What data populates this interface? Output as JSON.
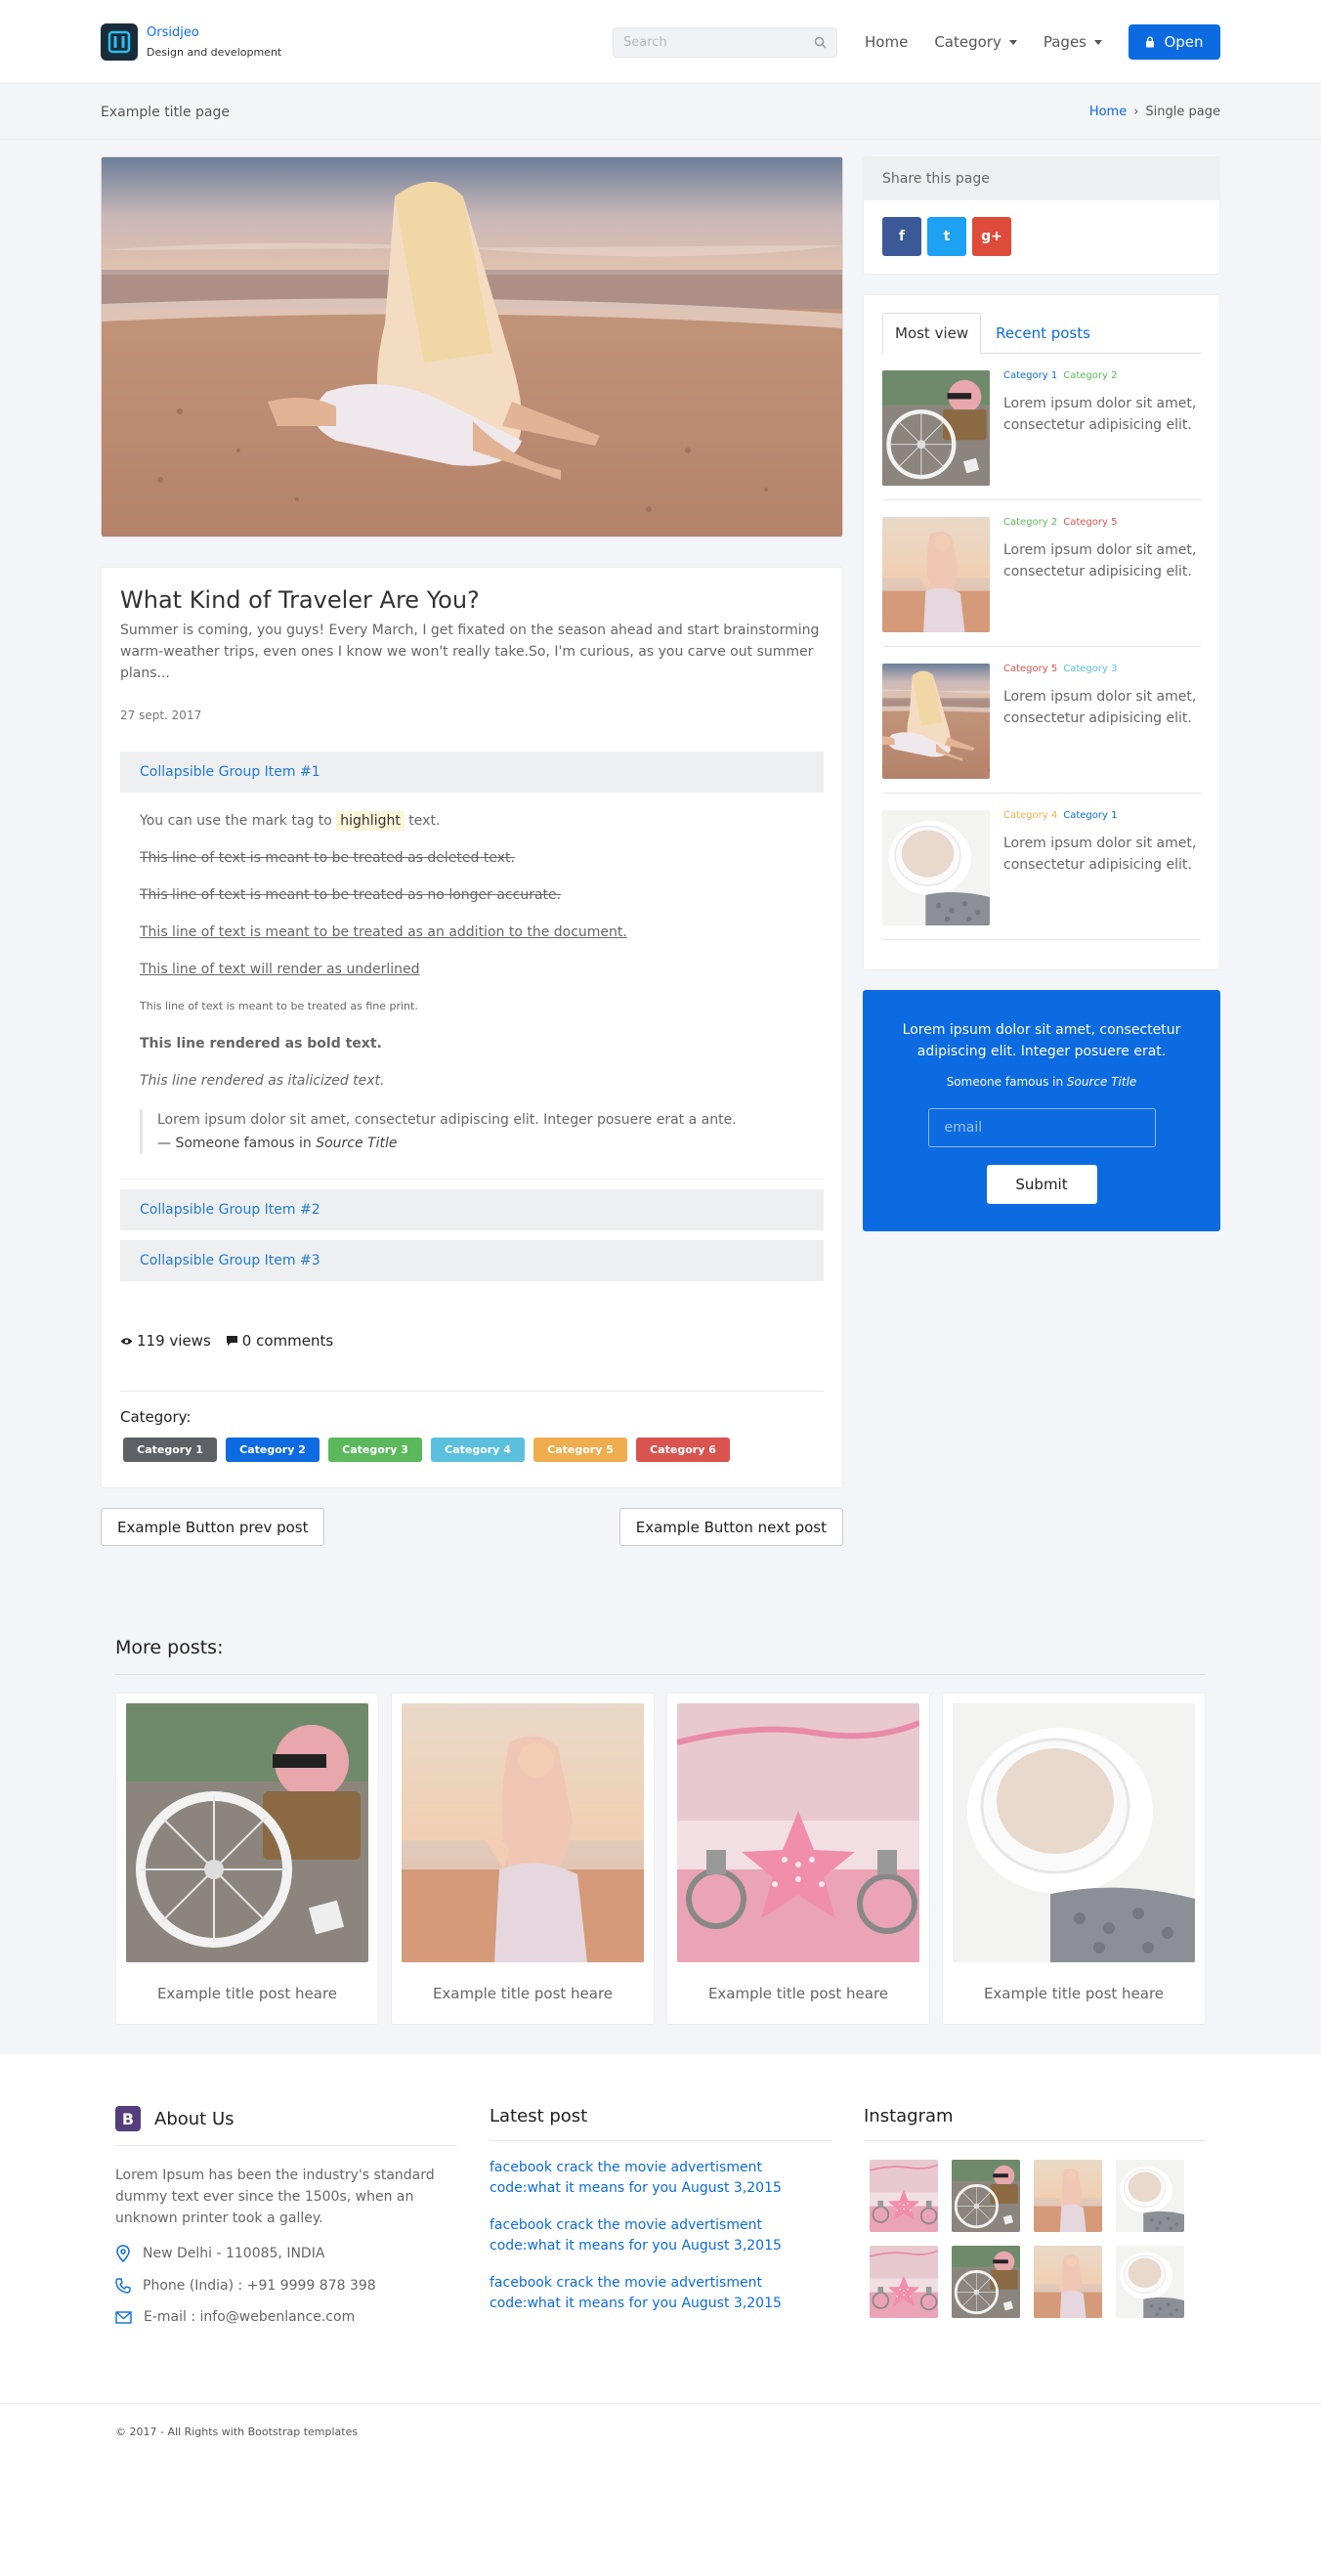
{
  "brand": {
    "name": "Orsidjeo",
    "tagline": "Design and development"
  },
  "nav": {
    "search_placeholder": "Search",
    "home": "Home",
    "category": "Category",
    "pages": "Pages",
    "open_button": "Open"
  },
  "breadcrumb": {
    "page_title": "Example title page",
    "home": "Home",
    "separator": "›",
    "current": "Single page"
  },
  "article": {
    "title": "What Kind of Traveler Are You?",
    "lead": "Summer is coming, you guys! Every March, I get fixated on the season ahead and start brainstorming warm-weather trips, even ones I know we won't really take.So, I'm curious, as you carve out summer plans...",
    "date": "27 sept. 2017",
    "collapse": [
      {
        "label": "Collapsible Group Item #1"
      },
      {
        "label": "Collapsible Group Item #2"
      },
      {
        "label": "Collapsible Group Item #3"
      }
    ],
    "body": {
      "mark_prefix": "You can use the mark tag to",
      "mark_word": "highlight",
      "mark_suffix": "text.",
      "deleted": "This line of text is meant to be treated as deleted text.",
      "strike": "This line of text is meant to be treated as no longer accurate.",
      "insert": "This line of text is meant to be treated as an addition to the document.",
      "underline": "This line of text will render as underlined",
      "fine": "This line of text is meant to be treated as fine print.",
      "bold": "This line rendered as bold text.",
      "italic": "This line rendered as italicized text.",
      "quote": "Lorem ipsum dolor sit amet, consectetur adipiscing elit. Integer posuere erat a ante.",
      "quote_from": "— Someone famous in",
      "quote_source": "Source Title"
    },
    "views": "119 views",
    "comments": "0 comments",
    "category_label": "Category:",
    "tags": [
      {
        "label": "Category 1",
        "color": "#5d6166"
      },
      {
        "label": "Category 2",
        "color": "#0c6be0"
      },
      {
        "label": "Category 3",
        "color": "#5cb85c"
      },
      {
        "label": "Category 4",
        "color": "#5bc0de"
      },
      {
        "label": "Category 5",
        "color": "#f0ad4e"
      },
      {
        "label": "Category 6",
        "color": "#d9534f"
      }
    ],
    "prev_button": "Example Button prev post",
    "next_button": "Example Button next post"
  },
  "sidebar": {
    "share_title": "Share this page",
    "share_buttons": [
      {
        "icon": "facebook-icon",
        "label": "f",
        "color": "#3b5998"
      },
      {
        "icon": "twitter-icon",
        "label": "t",
        "color": "#1da1f2"
      },
      {
        "icon": "google-plus-icon",
        "label": "g+",
        "color": "#dd4b39"
      }
    ],
    "tabs": [
      "Most view",
      "Recent posts"
    ],
    "posts": [
      {
        "cats": [
          {
            "label": "Category 1",
            "color": "#0c6be0"
          },
          {
            "label": "Category 2",
            "color": "#5cb85c"
          }
        ],
        "text": "Lorem ipsum dolor sit amet, consectetur adipisicing elit.",
        "image": "bicycle"
      },
      {
        "cats": [
          {
            "label": "Category 2",
            "color": "#5cb85c"
          },
          {
            "label": "Category 5",
            "color": "#d9534f"
          }
        ],
        "text": "Lorem ipsum dolor sit amet, consectetur adipisicing elit.",
        "image": "beach-girl"
      },
      {
        "cats": [
          {
            "label": "Category 5",
            "color": "#d9534f"
          },
          {
            "label": "Category 3",
            "color": "#5bc0de"
          }
        ],
        "text": "Lorem ipsum dolor sit amet, consectetur adipisicing elit.",
        "image": "beach-sitting"
      },
      {
        "cats": [
          {
            "label": "Category 4",
            "color": "#f0ad4e"
          },
          {
            "label": "Category 1",
            "color": "#0c6be0"
          }
        ],
        "text": "Lorem ipsum dolor sit amet, consectetur adipisicing elit.",
        "image": "coffee-cup"
      }
    ],
    "subscribe": {
      "title": "Lorem ipsum dolor sit amet, consectetur adipiscing elit. Integer posuere erat.",
      "source_prefix": "Someone famous in",
      "source_title": "Source Title",
      "email_placeholder": "email",
      "submit": "Submit"
    }
  },
  "more_posts": {
    "title": "More posts:",
    "items": [
      {
        "title": "Example title post heare",
        "image": "bicycle"
      },
      {
        "title": "Example title post heare",
        "image": "beach-girl"
      },
      {
        "title": "Example title post heare",
        "image": "starfish-jewelry"
      },
      {
        "title": "Example title post heare",
        "image": "coffee-cup"
      }
    ]
  },
  "footer": {
    "about_title": "About Us",
    "about_badge": "B",
    "about_text": "Lorem Ipsum has been the industry's standard dummy text ever since the 1500s, when an unknown printer took a galley.",
    "address": "New Delhi - 110085, INDIA",
    "phone": "Phone (India) : +91 9999 878 398",
    "email": "E-mail : info@webenlance.com",
    "latest_title": "Latest post",
    "latest": [
      "facebook crack the movie advertisment code:what it means for you August 3,2015",
      "facebook crack the movie advertisment code:what it means for you August 3,2015",
      "facebook crack the movie advertisment code:what it means for you August 3,2015"
    ],
    "instagram_title": "Instagram",
    "instagram": [
      "starfish-jewelry",
      "bicycle",
      "beach-girl",
      "coffee-cup",
      "starfish-jewelry",
      "bicycle",
      "beach-girl",
      "coffee-cup"
    ],
    "copyright": "© 2017 - All Rights with Bootstrap templates"
  },
  "colors": {
    "primary": "#0c6be0",
    "background": "#f4f5f9"
  }
}
